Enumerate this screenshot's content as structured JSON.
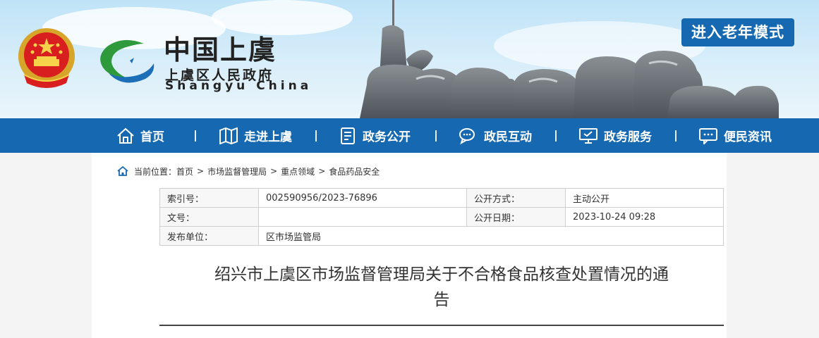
{
  "banner": {
    "site_name_cn": "中国上虞",
    "site_sub": "上虞区人民政府",
    "site_en": "Shangyu  China",
    "elder_mode_label": "进入老年模式",
    "emblem_icon": "national-emblem-icon",
    "logo_icon": "shangyu-logo-icon"
  },
  "nav": {
    "items": [
      {
        "label": "首页",
        "icon": "home-icon"
      },
      {
        "label": "走进上虞",
        "icon": "map-icon"
      },
      {
        "label": "政务公开",
        "icon": "document-icon"
      },
      {
        "label": "政民互动",
        "icon": "chat-icon"
      },
      {
        "label": "政务服务",
        "icon": "monitor-icon"
      },
      {
        "label": "便民资讯",
        "icon": "message-icon"
      }
    ]
  },
  "breadcrumb": {
    "prefix": "当前位置：",
    "items": [
      "首页",
      "市场监督管理局",
      "重点领域",
      "食品药品安全"
    ],
    "separator": ">"
  },
  "meta": {
    "index_label": "索引号：",
    "index_value": "002590956/2023-76896",
    "open_method_label": "公开方式：",
    "open_method_value": "主动公开",
    "doc_no_label": "文号：",
    "doc_no_value": "",
    "open_date_label": "公开日期：",
    "open_date_value": "2023-10-24 09:28",
    "publisher_label": "发布单位：",
    "publisher_value": "区市场监管局"
  },
  "article": {
    "title_line1": "绍兴市上虞区市场监督管理局关于不合格食品核查处置情况的通",
    "title_line2": "告"
  },
  "colors": {
    "nav_blue": "#1669b0",
    "text": "#333333"
  }
}
